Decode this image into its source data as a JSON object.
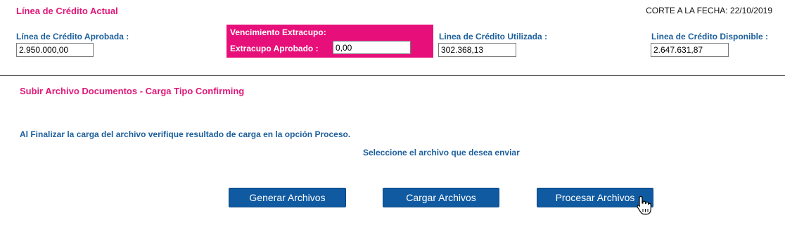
{
  "header": {
    "title": "Línea de Crédito Actual",
    "cut_date": "CORTE A LA FECHA: 22/10/2019"
  },
  "credit": {
    "approved_label": "Línea de Crédito Aprobada :",
    "approved_value": "2.950.000,00",
    "overdraft_due_label": "Vencimiento Extracupo:",
    "overdraft_approved_label": "Extracupo Aprobado :",
    "overdraft_approved_value": "0,00",
    "used_label": "Linea de Crédito Utilizada :",
    "used_value": "302.368,13",
    "available_label": "Linea de Crédito Disponible :",
    "available_value": "2.647.631,87"
  },
  "upload": {
    "section_title": "Subir Archivo Documentos - Carga Tipo Confirming",
    "instruction": "Al Finalizar la carga del archivo verifique resultado de carga en la opción Proceso.",
    "select_prompt": "Seleccione el archivo que desea enviar"
  },
  "buttons": {
    "generate": "Generar Archivos",
    "load": "Cargar Archivos",
    "process": "Procesar Archivos"
  },
  "colors": {
    "accent_pink": "#e7107a",
    "label_blue": "#1c5f9c",
    "button_blue": "#0f5aa1"
  }
}
